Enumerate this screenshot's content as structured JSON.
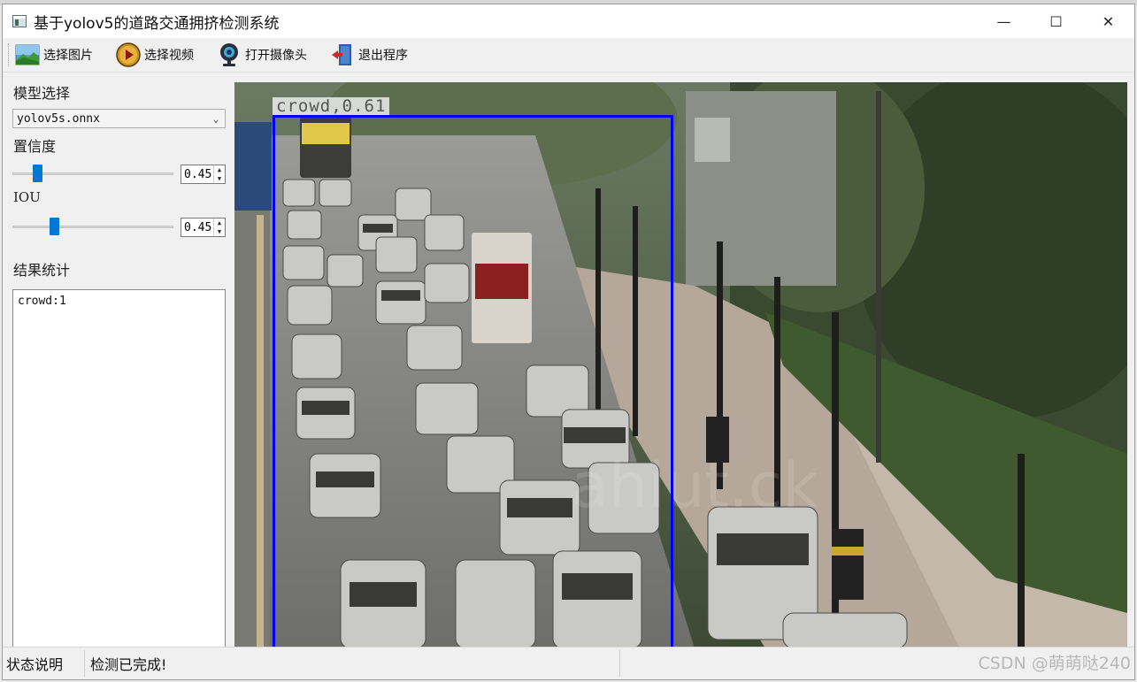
{
  "window": {
    "title": "基于yolov5的道路交通拥挤检测系统",
    "minimize_glyph": "—",
    "maximize_glyph": "☐",
    "close_glyph": "✕"
  },
  "toolbar": {
    "items": [
      {
        "label": "选择图片",
        "icon": "image-icon"
      },
      {
        "label": "选择视频",
        "icon": "play-video-icon"
      },
      {
        "label": "打开摄像头",
        "icon": "webcam-icon"
      },
      {
        "label": "退出程序",
        "icon": "exit-door-icon"
      }
    ]
  },
  "left_panel": {
    "model_label": "模型选择",
    "model_value": "yolov5s.onnx",
    "confidence_label": "置信度",
    "confidence_value": "0.45",
    "confidence_level": 0.45,
    "iou_label": "IOU",
    "iou_value": "0.45",
    "iou_level": 0.45,
    "results_label": "结果统计",
    "results_text": "crowd:1"
  },
  "detection": {
    "label": "crowd,0.61",
    "box_color": "#0000ff"
  },
  "statusbar": {
    "label": "状态说明",
    "message": "检测已完成!"
  },
  "watermark": "CSDN @萌萌哒240"
}
